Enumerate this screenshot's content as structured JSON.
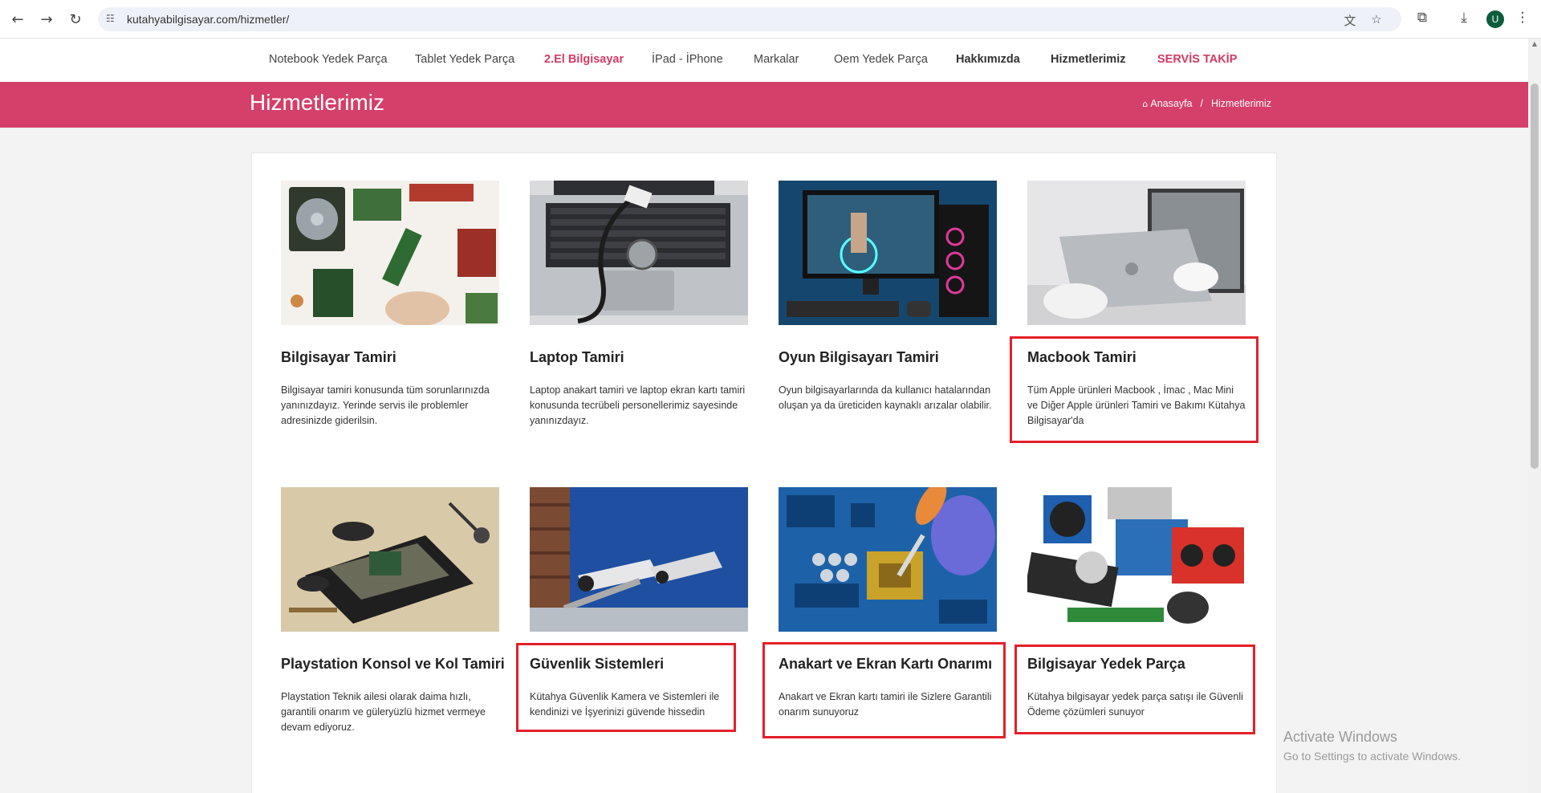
{
  "browser": {
    "url": "kutahyabilgisayar.com/hizmetler/",
    "profile_initial": "U",
    "icons": {
      "back": "arrow-left-icon",
      "forward": "arrow-right-icon",
      "reload": "reload-icon",
      "site_info": "tune-icon",
      "translate": "translate-icon",
      "bookmark": "star-icon",
      "extensions": "puzzle-icon",
      "download": "download-icon",
      "menu": "kebab-menu-icon"
    }
  },
  "nav": {
    "items": [
      {
        "label": "Notebook Yedek Parça"
      },
      {
        "label": "Tablet Yedek Parça"
      },
      {
        "label": "2.El Bilgisayar"
      },
      {
        "label": "İPad - İPhone"
      },
      {
        "label": "Markalar"
      },
      {
        "label": "Oem Yedek Parça"
      },
      {
        "label": "Hakkımızda"
      },
      {
        "label": "Hizmetlerimiz"
      },
      {
        "label": "SERVİS TAKİP"
      }
    ]
  },
  "header": {
    "title": "Hizmetlerimiz",
    "breadcrumb_home": "Anasayfa",
    "breadcrumb_sep": "/",
    "breadcrumb_current": "Hizmetlerimiz"
  },
  "colors": {
    "accent": "#d4406a",
    "highlight": "#e3202a"
  },
  "services": [
    {
      "title": "Bilgisayar Tamiri",
      "text": "Bilgisayar tamiri konusunda tüm sorunlarınızda yanınızdayız. Yerinde servis ile problemler adresinizde giderilsin."
    },
    {
      "title": "Laptop Tamiri",
      "text": "Laptop anakart tamiri ve laptop ekran kartı tamiri konusunda tecrübeli personellerimiz sayesinde yanınızdayız."
    },
    {
      "title": "Oyun Bilgisayarı Tamiri",
      "text": "Oyun bilgisayarlarında da kullanıcı hatalarından oluşan ya da üreticiden kaynaklı arızalar olabilir."
    },
    {
      "title": "Macbook Tamiri",
      "text": "Tüm Apple ürünleri Macbook , İmac , Mac Mini ve Diğer Apple ürünleri Tamiri ve Bakımı Kütahya Bilgisayar'da"
    },
    {
      "title": "Playstation Konsol ve Kol Tamiri",
      "text": "Playstation Teknik ailesi olarak daima hızlı, garantili onarım ve güleryüzlü hizmet vermeye devam ediyoruz."
    },
    {
      "title": "Güvenlik Sistemleri",
      "text": "Kütahya Güvenlik Kamera ve Sistemleri ile kendinizi ve İşyerinizi güvende hissedin"
    },
    {
      "title": "Anakart ve Ekran Kartı Onarımı",
      "text": "Anakart ve Ekran kartı tamiri ile Sizlere Garantili onarım sunuyoruz"
    },
    {
      "title": "Bilgisayar Yedek Parça",
      "text": "Kütahya bilgisayar yedek parça satışı ile Güvenli Ödeme çözümleri sunuyor"
    }
  ],
  "watermark": {
    "line1": "Activate Windows",
    "line2": "Go to Settings to activate Windows."
  }
}
